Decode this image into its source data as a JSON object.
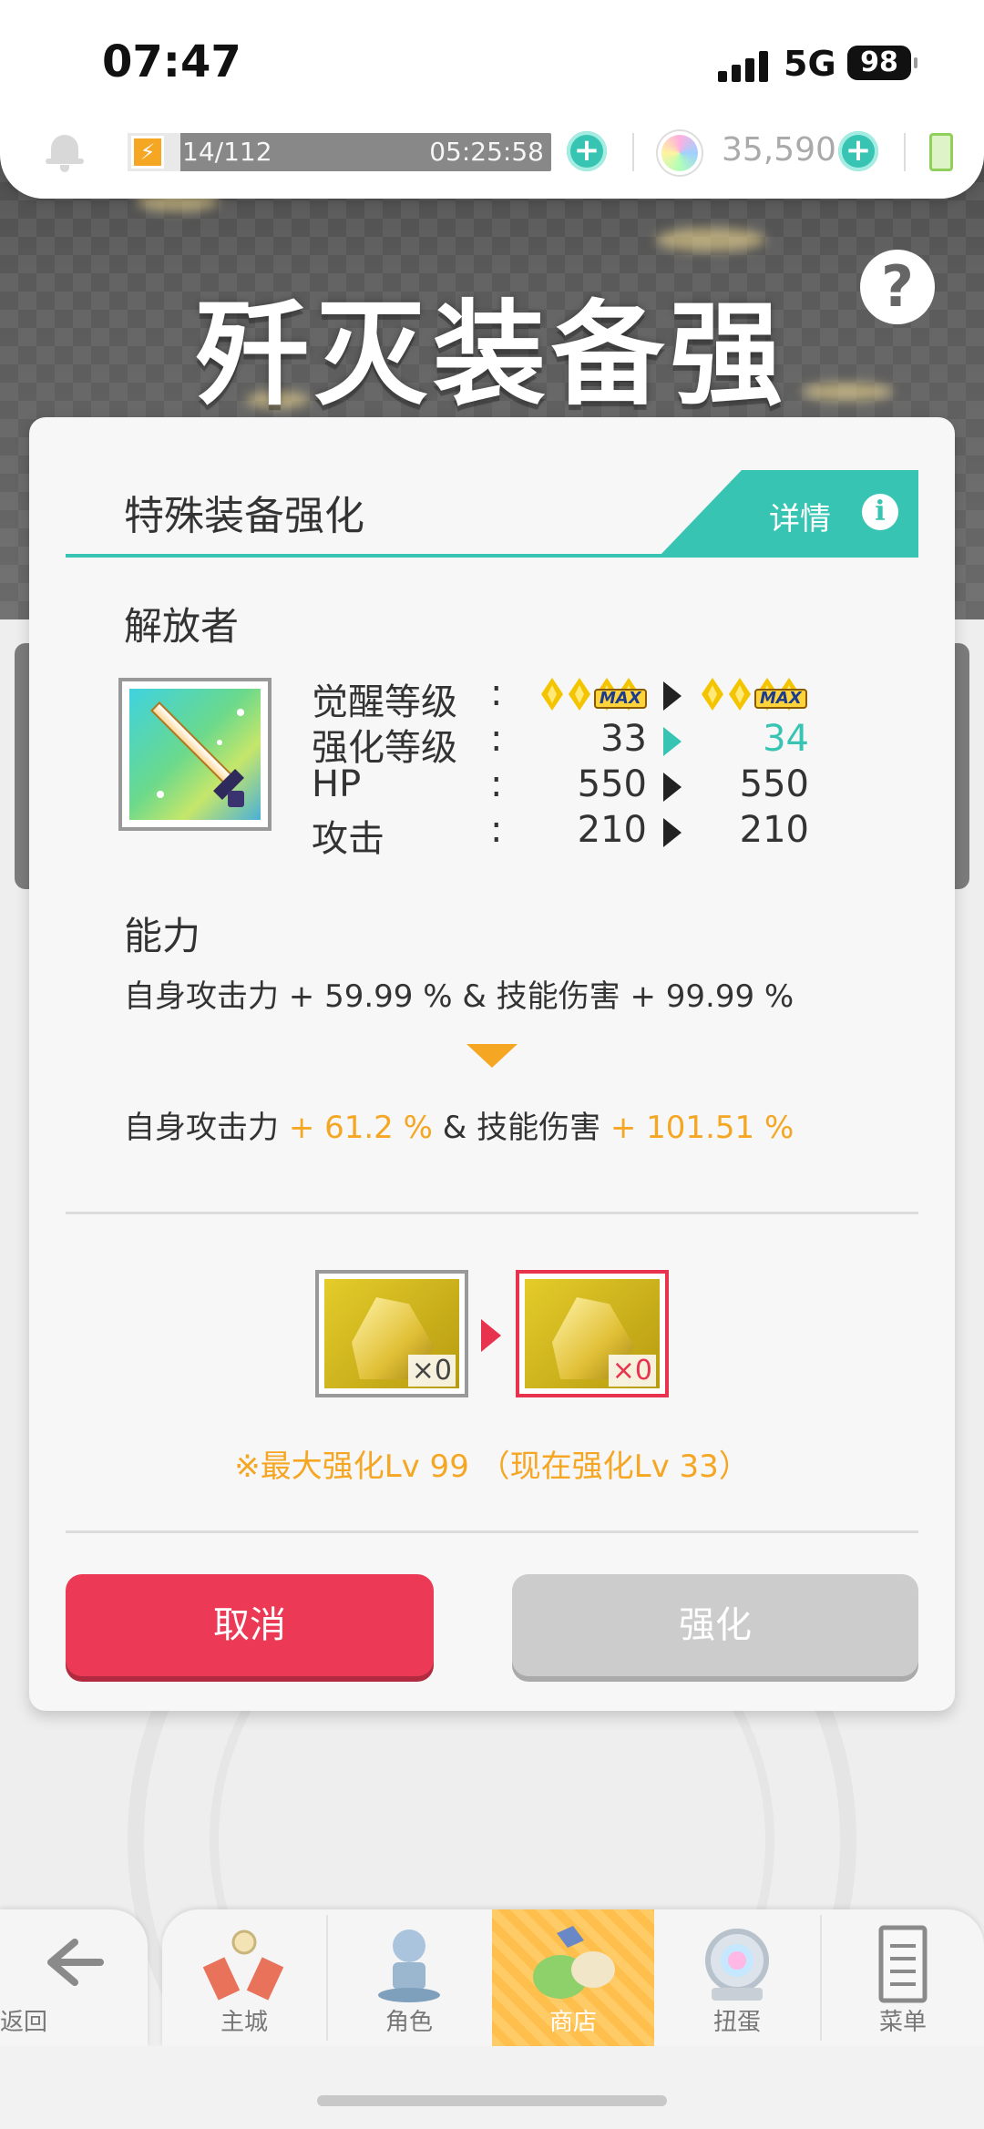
{
  "status_bar": {
    "time": "07:47",
    "network": "5G",
    "battery": "98"
  },
  "resource_bar": {
    "stamina_text": "14/112",
    "stamina_fill_fraction": 0.125,
    "stamina_timer": "05:25:58",
    "gems": "35,590",
    "plus_glyph": "+"
  },
  "page_title": "歼灭装备强化",
  "help_glyph": "?",
  "modal": {
    "title": "特殊装备强化",
    "details_label": "详情",
    "info_glyph": "i",
    "liberator_label": "解放者",
    "stats": [
      {
        "name": "觉醒等级",
        "colon": ":",
        "current": "",
        "new": "",
        "highlight": false,
        "is_awakening": true
      },
      {
        "name": "强化等级",
        "colon": ":",
        "current": "33",
        "new": "34",
        "highlight": true
      },
      {
        "name": "HP",
        "colon": ":",
        "current": "550",
        "new": "550",
        "highlight": false
      },
      {
        "name": "攻击",
        "colon": ":",
        "current": "210",
        "new": "210",
        "highlight": false
      }
    ],
    "awakening_max_label": "MAX",
    "ability_label": "能力",
    "ability_current": {
      "p1": "自身攻击力 + 59.99 % & 技能伤害 + 99.99 %"
    },
    "ability_new": {
      "p1": "自身攻击力 ",
      "v1": "+ 61.2 %",
      "p2": " & 技能伤害 ",
      "v2": "+ 101.51 %"
    },
    "material_current_count": "×0",
    "material_new_count": "×0",
    "max_note": "※最大强化Lv 99 （现在强化Lv 33）",
    "cancel_label": "取消",
    "enhance_label": "强化"
  },
  "nav": {
    "back": "返回",
    "items": [
      {
        "label": "主城",
        "icon": "castle-icon"
      },
      {
        "label": "角色",
        "icon": "character-icon"
      },
      {
        "label": "商店",
        "icon": "shop-icon",
        "active": true
      },
      {
        "label": "扭蛋",
        "icon": "gacha-icon"
      },
      {
        "label": "菜单",
        "icon": "menu-icon"
      }
    ]
  },
  "colors": {
    "teal": "#37c4b3",
    "orange": "#f5a623",
    "red": "#ec3a56",
    "disabled": "#cccccc"
  }
}
